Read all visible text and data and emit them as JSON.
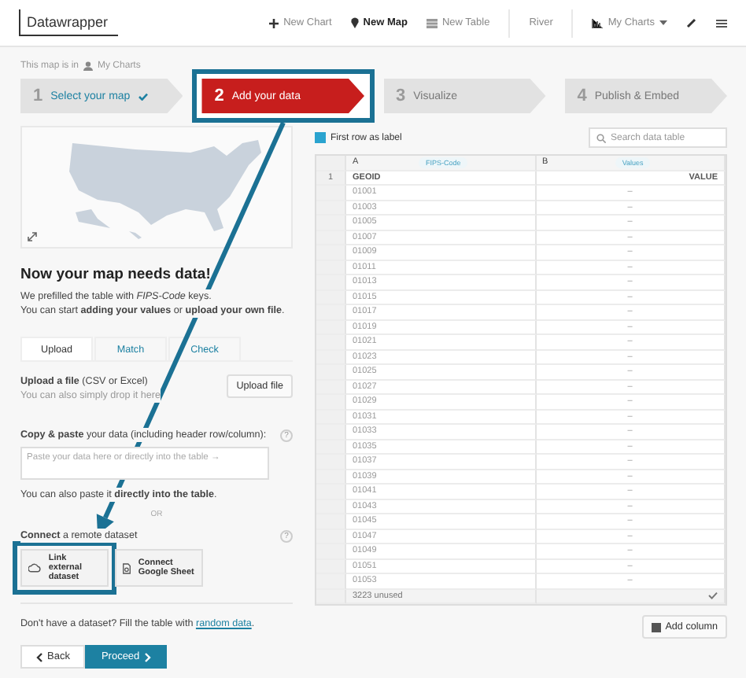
{
  "header": {
    "logo": "Datawrapper",
    "nav": [
      {
        "label": "New Chart",
        "selected": false
      },
      {
        "label": "New Map",
        "selected": true
      },
      {
        "label": "New Table",
        "selected": false
      }
    ],
    "user": "River",
    "my_charts": "My Charts"
  },
  "location": {
    "prefix": "This map is in",
    "folder": "My Charts"
  },
  "steps": [
    {
      "number": "1",
      "label": "Select your map",
      "done": true,
      "selected": false,
      "highlighted": false
    },
    {
      "number": "2",
      "label": "Add your data",
      "done": false,
      "selected": true,
      "highlighted": true
    },
    {
      "number": "3",
      "label": "Visualize",
      "done": false,
      "selected": false,
      "highlighted": false
    },
    {
      "number": "4",
      "label": "Publish & Embed",
      "done": false,
      "selected": false,
      "highlighted": false
    }
  ],
  "intro": {
    "heading": "Now your map needs data!",
    "text": "We prefilled the table with *FIPS-Code* keys.",
    "text2": "You can start **adding your values** or **upload your own file**."
  },
  "tabs": [
    {
      "label": "Upload",
      "selected": true
    },
    {
      "label": "Match",
      "selected": false
    },
    {
      "label": "Check",
      "selected": false
    }
  ],
  "upload": {
    "label": "**Upload a file** (CSV or Excel)",
    "hint": "You can also simply drop it here",
    "button": "Upload file"
  },
  "paste": {
    "label": "**Copy & paste** your data (including header row/column):",
    "help": "?",
    "placeholder": "Paste your data here or directly into the table →",
    "note": "You can also paste it **directly into the table**."
  },
  "separator": "OR",
  "remote": {
    "label": "**Connect** a remote dataset",
    "help": "?",
    "buttons": [
      {
        "label": "Link external dataset",
        "highlighted": true
      },
      {
        "label": "Connect Google Sheet",
        "highlighted": false
      }
    ]
  },
  "random": {
    "text": "Don't have a dataset? Fill the table with",
    "link": "random data",
    "end": "."
  },
  "nav_buttons": {
    "back": "Back",
    "proceed": "Proceed"
  },
  "table_options": {
    "first_row_label": {
      "label": "First row as label",
      "checked": true
    },
    "search": {
      "placeholder": "Search data table"
    }
  },
  "table": {
    "columns": [
      {
        "letter": "A",
        "type": "FIPS-Code"
      },
      {
        "letter": "B",
        "type": "Values"
      }
    ],
    "header_row": {
      "number": "1",
      "cells": [
        "GEOID",
        "VALUE"
      ]
    },
    "rows": [
      {
        "cells": [
          "01001",
          "–"
        ]
      },
      {
        "cells": [
          "01003",
          "–"
        ]
      },
      {
        "cells": [
          "01005",
          "–"
        ]
      },
      {
        "cells": [
          "01007",
          "–"
        ]
      },
      {
        "cells": [
          "01009",
          "–"
        ]
      },
      {
        "cells": [
          "01011",
          "–"
        ]
      },
      {
        "cells": [
          "01013",
          "–"
        ]
      },
      {
        "cells": [
          "01015",
          "–"
        ]
      },
      {
        "cells": [
          "01017",
          "–"
        ]
      },
      {
        "cells": [
          "01019",
          "–"
        ]
      },
      {
        "cells": [
          "01021",
          "–"
        ]
      },
      {
        "cells": [
          "01023",
          "–"
        ]
      },
      {
        "cells": [
          "01025",
          "–"
        ]
      },
      {
        "cells": [
          "01027",
          "–"
        ]
      },
      {
        "cells": [
          "01029",
          "–"
        ]
      },
      {
        "cells": [
          "01031",
          "–"
        ]
      },
      {
        "cells": [
          "01033",
          "–"
        ]
      },
      {
        "cells": [
          "01035",
          "–"
        ]
      },
      {
        "cells": [
          "01037",
          "–"
        ]
      },
      {
        "cells": [
          "01039",
          "–"
        ]
      },
      {
        "cells": [
          "01041",
          "–"
        ]
      },
      {
        "cells": [
          "01043",
          "–"
        ]
      },
      {
        "cells": [
          "01045",
          "–"
        ]
      },
      {
        "cells": [
          "01047",
          "–"
        ]
      },
      {
        "cells": [
          "01049",
          "–"
        ]
      },
      {
        "cells": [
          "01051",
          "–"
        ]
      },
      {
        "cells": [
          "01053",
          "–"
        ]
      }
    ],
    "footer": "3223 unused"
  },
  "add_column": "Add column",
  "annotation": {
    "arrow": true
  }
}
